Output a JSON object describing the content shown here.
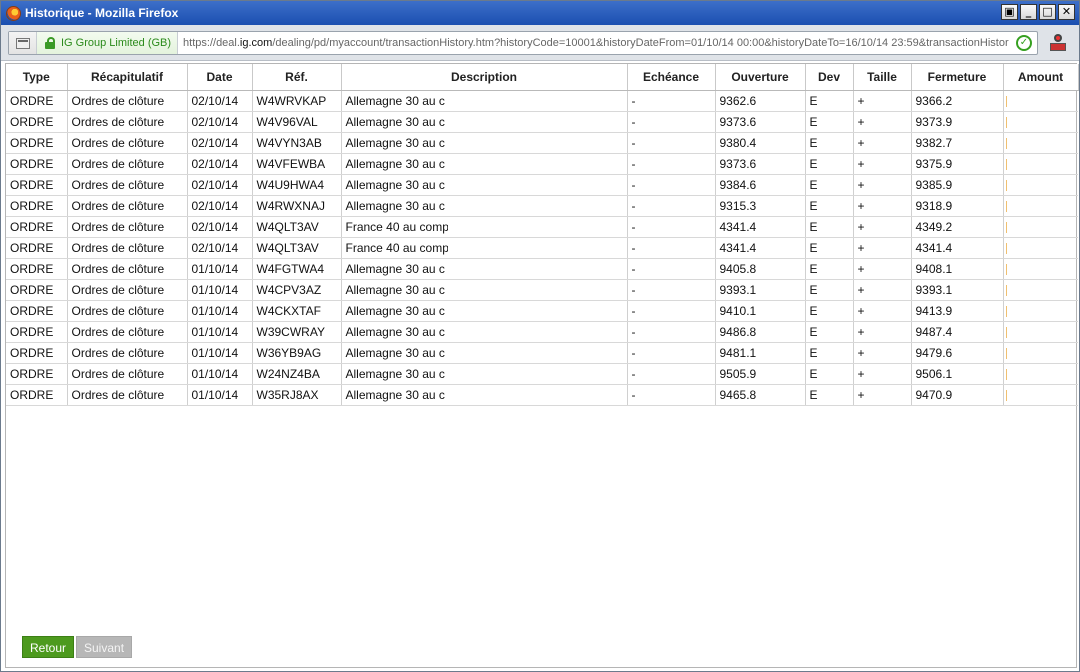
{
  "window": {
    "title": "Historique - Mozilla Firefox"
  },
  "urlbar": {
    "identity": "IG Group Limited (GB)",
    "url_prefix": "https://deal.",
    "url_domain": "ig.com",
    "url_rest": "/dealing/pd/myaccount/transactionHistory.htm?historyCode=10001&historyDateFrom=01/10/14 00:00&historyDateTo=16/10/14 23:59&transactionHistor"
  },
  "table": {
    "headers": [
      "Type",
      "Récapitulatif",
      "Date",
      "Réf.",
      "Description",
      "Echéance",
      "Ouverture",
      "Dev",
      "Taille",
      "Fermeture",
      "Amount"
    ],
    "rows": [
      [
        "ORDRE",
        "Ordres de clôture",
        "02/10/14",
        "W4WRVKAP",
        "Allemagne 30 au c",
        "-",
        "9362.6",
        "E",
        "+",
        "9366.2",
        ""
      ],
      [
        "ORDRE",
        "Ordres de clôture",
        "02/10/14",
        "W4V96VAL",
        "Allemagne 30 au c",
        "-",
        "9373.6",
        "E",
        "+",
        "9373.9",
        ""
      ],
      [
        "ORDRE",
        "Ordres de clôture",
        "02/10/14",
        "W4VYN3AB",
        "Allemagne 30 au c",
        "-",
        "9380.4",
        "E",
        "+",
        "9382.7",
        ""
      ],
      [
        "ORDRE",
        "Ordres de clôture",
        "02/10/14",
        "W4VFEWBA",
        "Allemagne 30 au c",
        "-",
        "9373.6",
        "E",
        "+",
        "9375.9",
        ""
      ],
      [
        "ORDRE",
        "Ordres de clôture",
        "02/10/14",
        "W4U9HWA4",
        "Allemagne 30 au c",
        "-",
        "9384.6",
        "E",
        "+",
        "9385.9",
        ""
      ],
      [
        "ORDRE",
        "Ordres de clôture",
        "02/10/14",
        "W4RWXNAJ",
        "Allemagne 30 au c",
        "-",
        "9315.3",
        "E",
        "+",
        "9318.9",
        ""
      ],
      [
        "ORDRE",
        "Ordres de clôture",
        "02/10/14",
        "W4QLT3AV",
        "France 40 au comp",
        "-",
        "4341.4",
        "E",
        "+",
        "4349.2",
        ""
      ],
      [
        "ORDRE",
        "Ordres de clôture",
        "02/10/14",
        "W4QLT3AV",
        "France 40 au comp",
        "-",
        "4341.4",
        "E",
        "+",
        "4341.4",
        ""
      ],
      [
        "ORDRE",
        "Ordres de clôture",
        "01/10/14",
        "W4FGTWA4",
        "Allemagne 30 au c",
        "-",
        "9405.8",
        "E",
        "+",
        "9408.1",
        ""
      ],
      [
        "ORDRE",
        "Ordres de clôture",
        "01/10/14",
        "W4CPV3AZ",
        "Allemagne 30 au c",
        "-",
        "9393.1",
        "E",
        "+",
        "9393.1",
        ""
      ],
      [
        "ORDRE",
        "Ordres de clôture",
        "01/10/14",
        "W4CKXTAF",
        "Allemagne 30 au c",
        "-",
        "9410.1",
        "E",
        "+",
        "9413.9",
        ""
      ],
      [
        "ORDRE",
        "Ordres de clôture",
        "01/10/14",
        "W39CWRAY",
        "Allemagne 30 au c",
        "-",
        "9486.8",
        "E",
        "+",
        "9487.4",
        ""
      ],
      [
        "ORDRE",
        "Ordres de clôture",
        "01/10/14",
        "W36YB9AG",
        "Allemagne 30 au c",
        "-",
        "9481.1",
        "E",
        "+",
        "9479.6",
        ""
      ],
      [
        "ORDRE",
        "Ordres de clôture",
        "01/10/14",
        "W24NZ4BA",
        "Allemagne 30 au c",
        "-",
        "9505.9",
        "E",
        "+",
        "9506.1",
        ""
      ],
      [
        "ORDRE",
        "Ordres de clôture",
        "01/10/14",
        "W35RJ8AX",
        "Allemagne 30 au c",
        "-",
        "9465.8",
        "E",
        "+",
        "9470.9",
        ""
      ]
    ]
  },
  "buttons": {
    "back": "Retour",
    "next": "Suivant"
  },
  "colors": {
    "accent_green": "#4d9a1e",
    "disabled_gray": "#b7b7b7",
    "titlebar_blue": "#1b4fb0"
  }
}
